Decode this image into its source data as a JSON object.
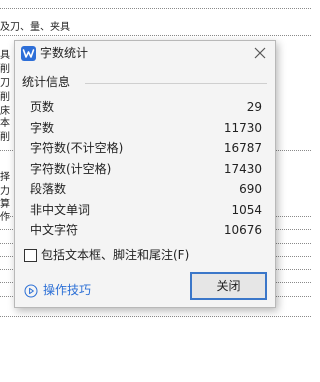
{
  "document": {
    "fragments": [
      "及刀、量、夹具",
      "具",
      "削",
      "刀",
      "削",
      "床",
      "本",
      "削",
      "择",
      "力",
      "算",
      "作"
    ]
  },
  "dialog": {
    "title": "字数统计",
    "section_label": "统计信息",
    "stats": [
      {
        "label": "页数",
        "value": "29"
      },
      {
        "label": "字数",
        "value": "11730"
      },
      {
        "label": "字符数(不计空格)",
        "value": "16787"
      },
      {
        "label": "字符数(计空格)",
        "value": "17430"
      },
      {
        "label": "段落数",
        "value": "690"
      },
      {
        "label": "非中文单词",
        "value": "1054"
      },
      {
        "label": "中文字符",
        "value": "10676"
      }
    ],
    "include_checkbox_label": "包括文本框、脚注和尾注(F)",
    "include_checked": false,
    "tips_label": "操作技巧",
    "close_button_label": "关闭",
    "icons": {
      "app": "wps-writer-icon",
      "close": "close-icon",
      "tips": "play-circle-icon"
    },
    "accent_color": "#3b77c9",
    "link_color": "#2b6fd6"
  }
}
